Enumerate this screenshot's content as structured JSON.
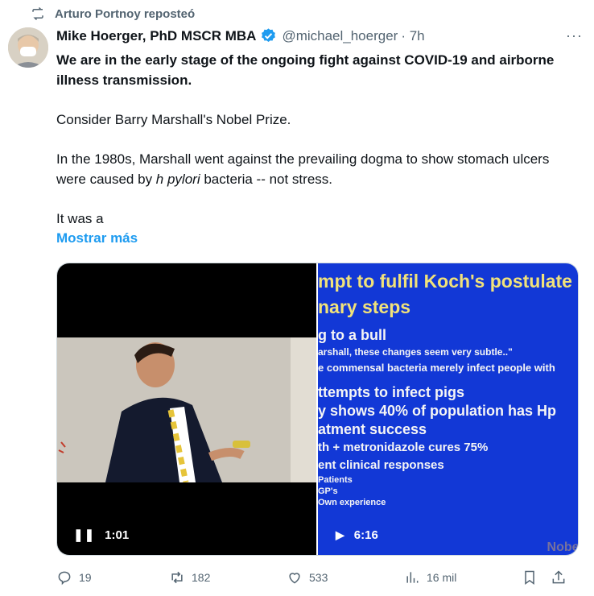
{
  "repost": {
    "label": "Arturo Portnoy reposteó",
    "icon": "repost-icon"
  },
  "author": {
    "name": "Mike Hoerger, PhD MSCR MBA",
    "handle": "@michael_hoerger",
    "time": "· 7h",
    "more": "···"
  },
  "tweet": {
    "lead": "We are in the early stage of the ongoing fight against COVID-19 and airborne illness transmission.",
    "p2": "Consider Barry Marshall's Nobel Prize.",
    "p3_before": "In the 1980s, Marshall went against the prevailing dogma to show stomach ulcers were caused by ",
    "p3_italic": "h pylori",
    "p3_after": " bacteria -- not stress.",
    "p4": "It was a",
    "show_more": "Mostrar más"
  },
  "media": {
    "video1": {
      "duration": "1:01"
    },
    "video2": {
      "duration": "6:16",
      "slide_lines": [
        "mpt to fulfil Koch's postulate",
        "nary steps",
        "g to a bull",
        "arshall, these changes seem very subtle..\"",
        "e commensal bacteria merely infect people with",
        "ttempts to infect pigs",
        "y shows 40% of population has Hp",
        "atment success",
        "th + metronidazole cures 75%",
        "ent clinical responses",
        "Patients",
        "GP's",
        "Own experience"
      ],
      "watermark": "Nobel"
    }
  },
  "actions": {
    "replies": "19",
    "reposts": "182",
    "likes": "533",
    "views": "16 mil"
  }
}
